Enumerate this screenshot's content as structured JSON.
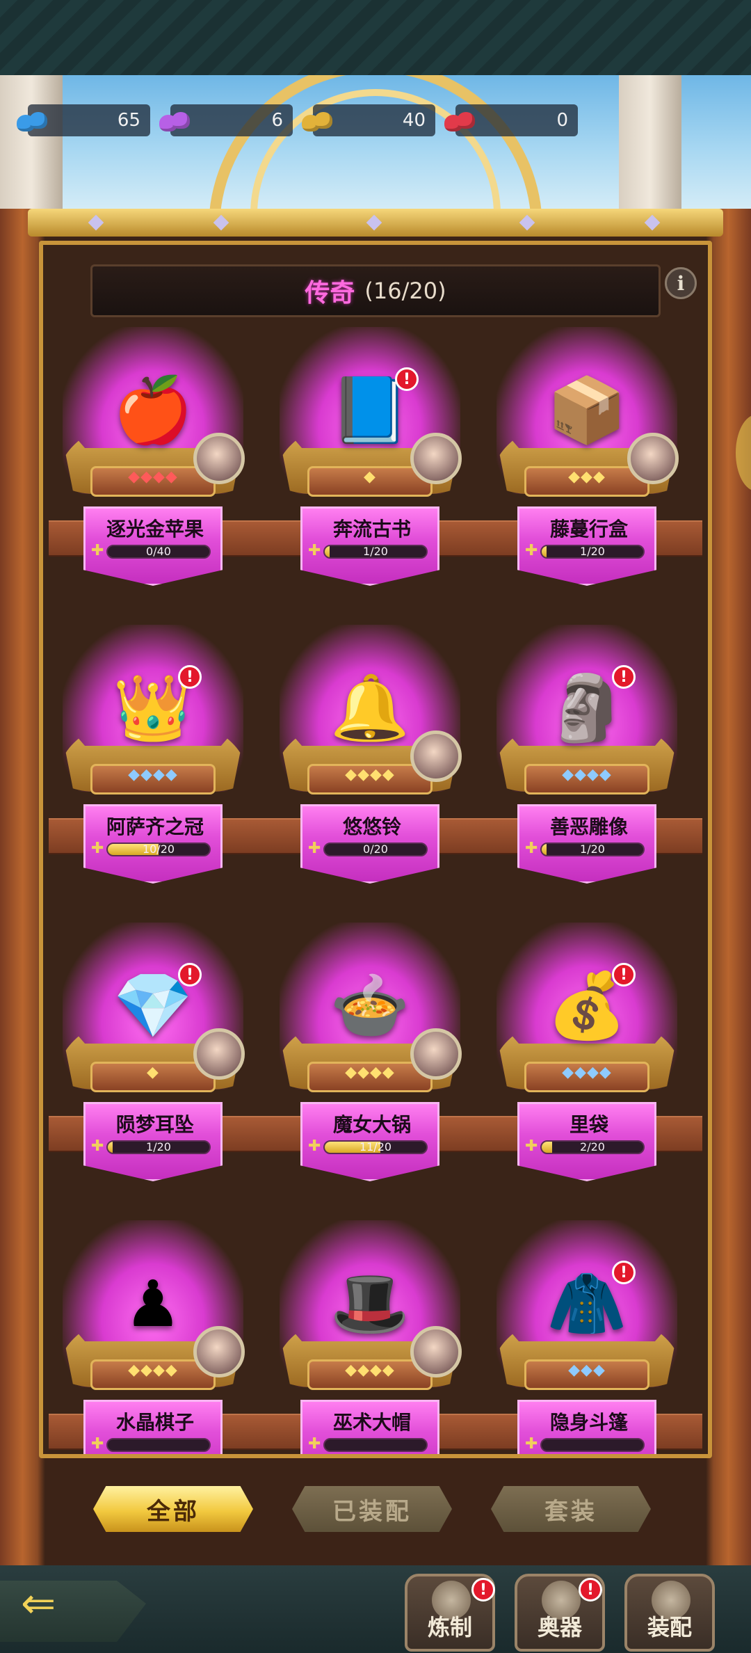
{
  "currencies": [
    {
      "icon": "blue-crystal-icon",
      "value": "65",
      "color": "#3a9be8"
    },
    {
      "icon": "purple-crystal-icon",
      "value": "6",
      "color": "#b760e6"
    },
    {
      "icon": "gold-crystal-icon",
      "value": "40",
      "color": "#e2b23a"
    },
    {
      "icon": "red-crystal-icon",
      "value": "0",
      "color": "#e23a4a"
    }
  ],
  "header": {
    "title": "传奇",
    "count": "(16/20)",
    "info_label": "i"
  },
  "items": [
    {
      "name": "逐光金苹果",
      "progress": "0/40",
      "fraction": 0,
      "stars": "◆◆◆◆",
      "star_color": "#ff5a5a",
      "alert": false,
      "avatar": true,
      "emoji": "🍎"
    },
    {
      "name": "奔流古书",
      "progress": "1/20",
      "fraction": 0.05,
      "stars": "◆",
      "star_color": "#ffe070",
      "alert": true,
      "avatar": true,
      "emoji": "📘"
    },
    {
      "name": "藤蔓行盒",
      "progress": "1/20",
      "fraction": 0.05,
      "stars": "◆◆◆",
      "star_color": "#ffe070",
      "alert": false,
      "avatar": true,
      "emoji": "📦"
    },
    {
      "name": "阿萨齐之冠",
      "progress": "10/20",
      "fraction": 0.5,
      "stars": "◆◆◆◆",
      "star_color": "#8ecbff",
      "alert": true,
      "avatar": false,
      "emoji": "👑"
    },
    {
      "name": "悠悠铃",
      "progress": "0/20",
      "fraction": 0,
      "stars": "◆◆◆◆",
      "star_color": "#ffe070",
      "alert": false,
      "avatar": true,
      "emoji": "🔔"
    },
    {
      "name": "善恶雕像",
      "progress": "1/20",
      "fraction": 0.05,
      "stars": "◆◆◆◆",
      "star_color": "#8ecbff",
      "alert": true,
      "avatar": false,
      "emoji": "🗿"
    },
    {
      "name": "陨梦耳坠",
      "progress": "1/20",
      "fraction": 0.05,
      "stars": "◆",
      "star_color": "#ffe070",
      "alert": true,
      "avatar": true,
      "emoji": "💎"
    },
    {
      "name": "魔女大锅",
      "progress": "11/20",
      "fraction": 0.55,
      "stars": "◆◆◆◆",
      "star_color": "#ffe070",
      "alert": false,
      "avatar": true,
      "emoji": "🍲"
    },
    {
      "name": "里袋",
      "progress": "2/20",
      "fraction": 0.1,
      "stars": "◆◆◆◆",
      "star_color": "#8ecbff",
      "alert": true,
      "avatar": false,
      "emoji": "💰"
    },
    {
      "name": "水晶棋子",
      "progress": "",
      "fraction": 0,
      "stars": "◆◆◆◆",
      "star_color": "#ffe070",
      "alert": false,
      "avatar": true,
      "emoji": "♟"
    },
    {
      "name": "巫术大帽",
      "progress": "",
      "fraction": 0,
      "stars": "◆◆◆◆",
      "star_color": "#ffe070",
      "alert": false,
      "avatar": true,
      "emoji": "🎩"
    },
    {
      "name": "隐身斗篷",
      "progress": "",
      "fraction": 0,
      "stars": "◆◆◆",
      "star_color": "#8ecbff",
      "alert": true,
      "avatar": false,
      "emoji": "🧥"
    }
  ],
  "filters": {
    "all": "全部",
    "equipped": "已装配",
    "set": "套装"
  },
  "nav": {
    "forge": "炼制",
    "artifact": "奥器",
    "equip": "装配"
  },
  "alert_mark": "!"
}
